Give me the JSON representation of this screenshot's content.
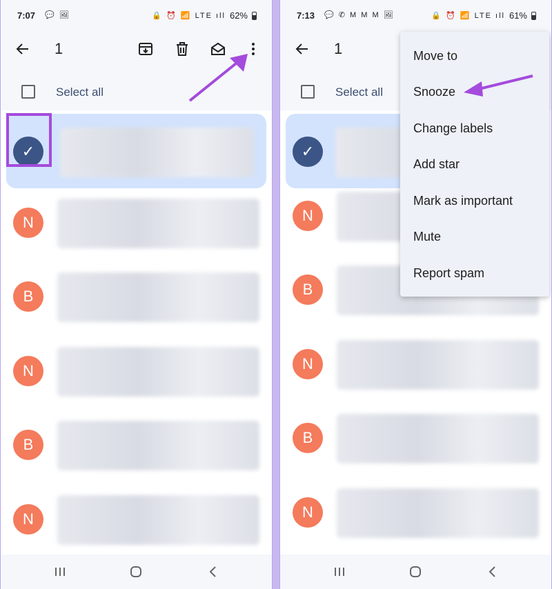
{
  "left": {
    "status": {
      "time": "7:07",
      "left_icons": "💬 🖼",
      "right_icons": "🔒 ⏰ 📶 LTE ıll",
      "battery": "62%"
    },
    "toolbar": {
      "selected_count": "1"
    },
    "select_all": {
      "label": "Select all"
    },
    "rows": [
      {
        "avatar": "✓",
        "selected": true
      },
      {
        "avatar": "N"
      },
      {
        "avatar": "B"
      },
      {
        "avatar": "N"
      },
      {
        "avatar": "B"
      },
      {
        "avatar": "N"
      }
    ]
  },
  "right": {
    "status": {
      "time": "7:13",
      "left_icons": "💬 ✆ M M M 🖼",
      "right_icons": "🔒 ⏰ 📶 LTE ıll",
      "battery": "61%"
    },
    "toolbar": {
      "selected_count": "1"
    },
    "select_all": {
      "label": "Select all"
    },
    "menu": {
      "items": [
        "Move to",
        "Snooze",
        "Change labels",
        "Add star",
        "Mark as important",
        "Mute",
        "Report spam"
      ]
    },
    "rows": [
      {
        "avatar": "✓",
        "selected": true
      },
      {
        "avatar": "N"
      },
      {
        "avatar": "B"
      },
      {
        "avatar": "N"
      },
      {
        "avatar": "B"
      },
      {
        "avatar": "N"
      }
    ]
  },
  "colors": {
    "accent_purple": "#a44bdc",
    "avatar_orange": "#f47b5c",
    "selected_blue": "#d3e3fd"
  }
}
